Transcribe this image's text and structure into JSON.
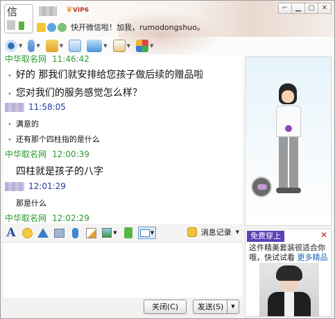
{
  "header": {
    "avatar_text": "信",
    "vip_label": "VIP6",
    "signature": "快开微信啦！加我，rumodongshuo。",
    "window_controls": [
      "⌐",
      "▁",
      "▢",
      "✕"
    ]
  },
  "toolbar": {
    "items": [
      "video-call",
      "voice-call",
      "send-file",
      "create-group",
      "remote-assist",
      "share-screen",
      "apps"
    ]
  },
  "chat": {
    "messages": [
      {
        "sender": "中华取名网",
        "time": "11:46:42",
        "sender_color": "#2d9a34"
      },
      {
        "lines": [
          "好的  那我们就安排给您孩子做后续的赠品啦",
          "您对我们的服务感觉怎么样？"
        ]
      },
      {
        "sender": "",
        "time": "11:58:05"
      },
      {
        "lines": [
          "满意的",
          "还有那个四柱指的是什么"
        ]
      },
      {
        "sender": "中华取名网",
        "time": "12:00:39"
      },
      {
        "lines": [
          "四柱就是孩子的八字"
        ]
      },
      {
        "sender": "",
        "time": "12:01:29"
      },
      {
        "lines": [
          "那是什么"
        ]
      },
      {
        "sender": "中华取名网",
        "time": "12:02:29"
      }
    ]
  },
  "input_toolbar": {
    "font_label": "A",
    "history_label": "消息记录"
  },
  "buttons": {
    "close": "关闭(C)",
    "send": "发送(S)",
    "send_dropdown": "▼"
  },
  "ad": {
    "tag": "免费穿上",
    "text": "这件精美套装很适合你哦，快试试看",
    "link": "更多精品",
    "close": "✕"
  }
}
